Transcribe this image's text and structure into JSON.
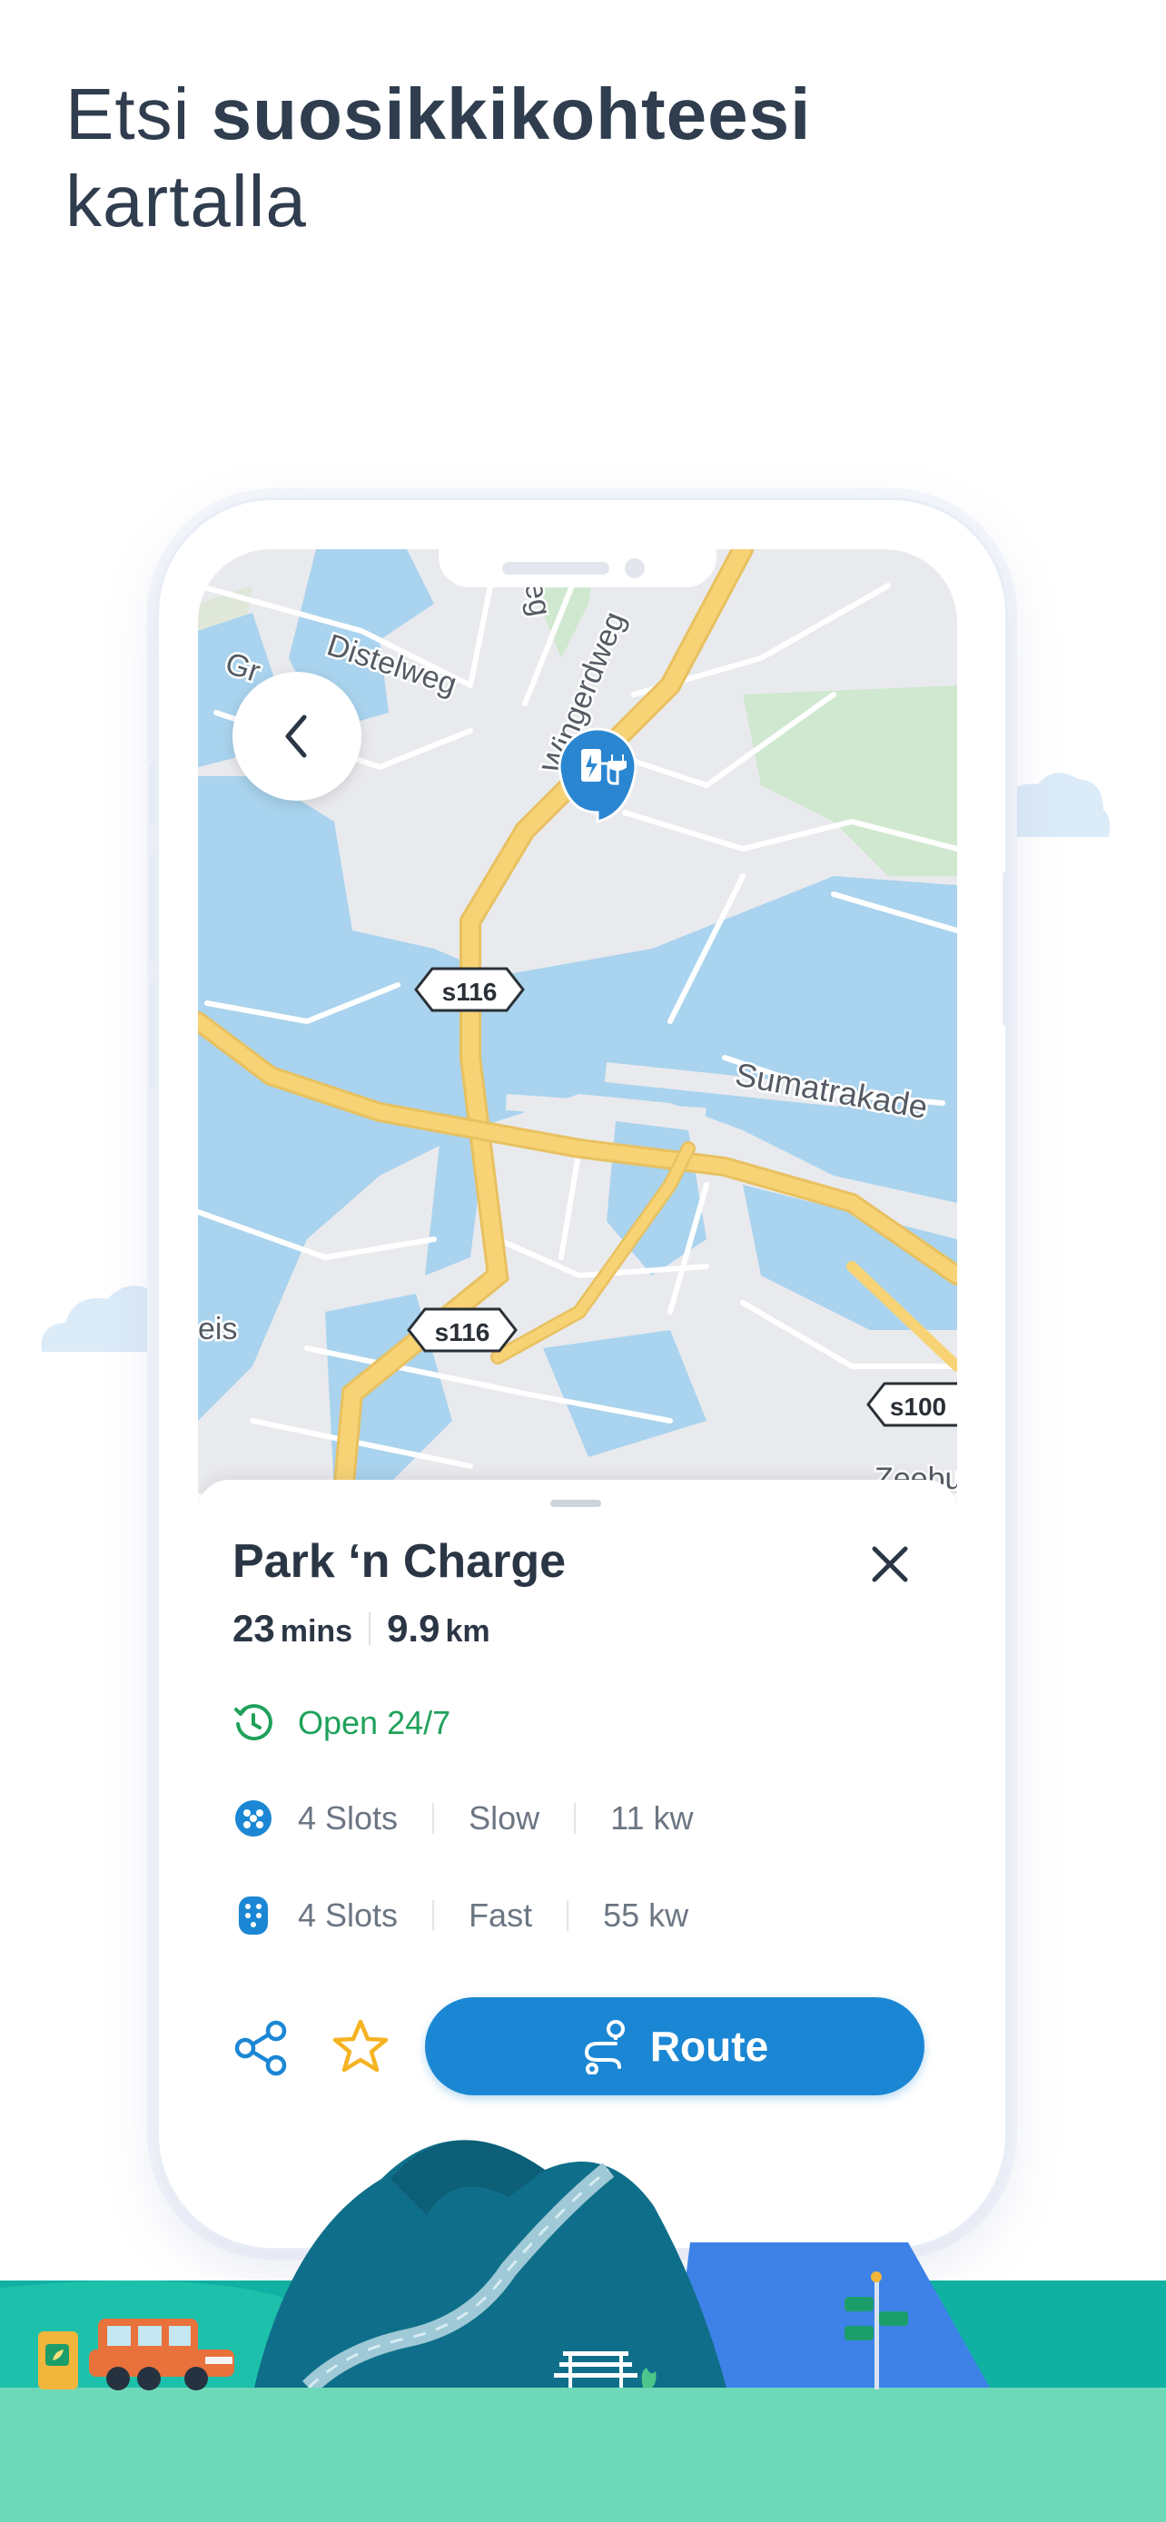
{
  "headline": {
    "prefix": "Etsi ",
    "bold": "suosikkikohteesi",
    "line2": "kartalla"
  },
  "map": {
    "street_labels": [
      "Distelweg",
      "Wingerdweg",
      "Sumatrakade",
      "eis",
      "Gr",
      "Zeebu",
      "eg"
    ],
    "road_shields": [
      "s116",
      "s116",
      "s100"
    ],
    "marker": "ev-charging-station"
  },
  "place": {
    "title": "Park ‘n Charge",
    "eta_value": "23",
    "eta_unit": "mins",
    "distance_value": "9.9",
    "distance_unit": "km",
    "hours": "Open 24/7",
    "connectors": [
      {
        "slots": "4 Slots",
        "speed": "Slow",
        "power": "11 kw",
        "icon": "type2-plug-icon"
      },
      {
        "slots": "4 Slots",
        "speed": "Fast",
        "power": "55 kw",
        "icon": "ccs-plug-icon"
      }
    ],
    "route_label": "Route"
  },
  "colors": {
    "primary": "#1b87d4",
    "open_green": "#1fa15a",
    "star": "#f5b322",
    "water": "#a9d3ee",
    "major_road": "#f7d376"
  }
}
